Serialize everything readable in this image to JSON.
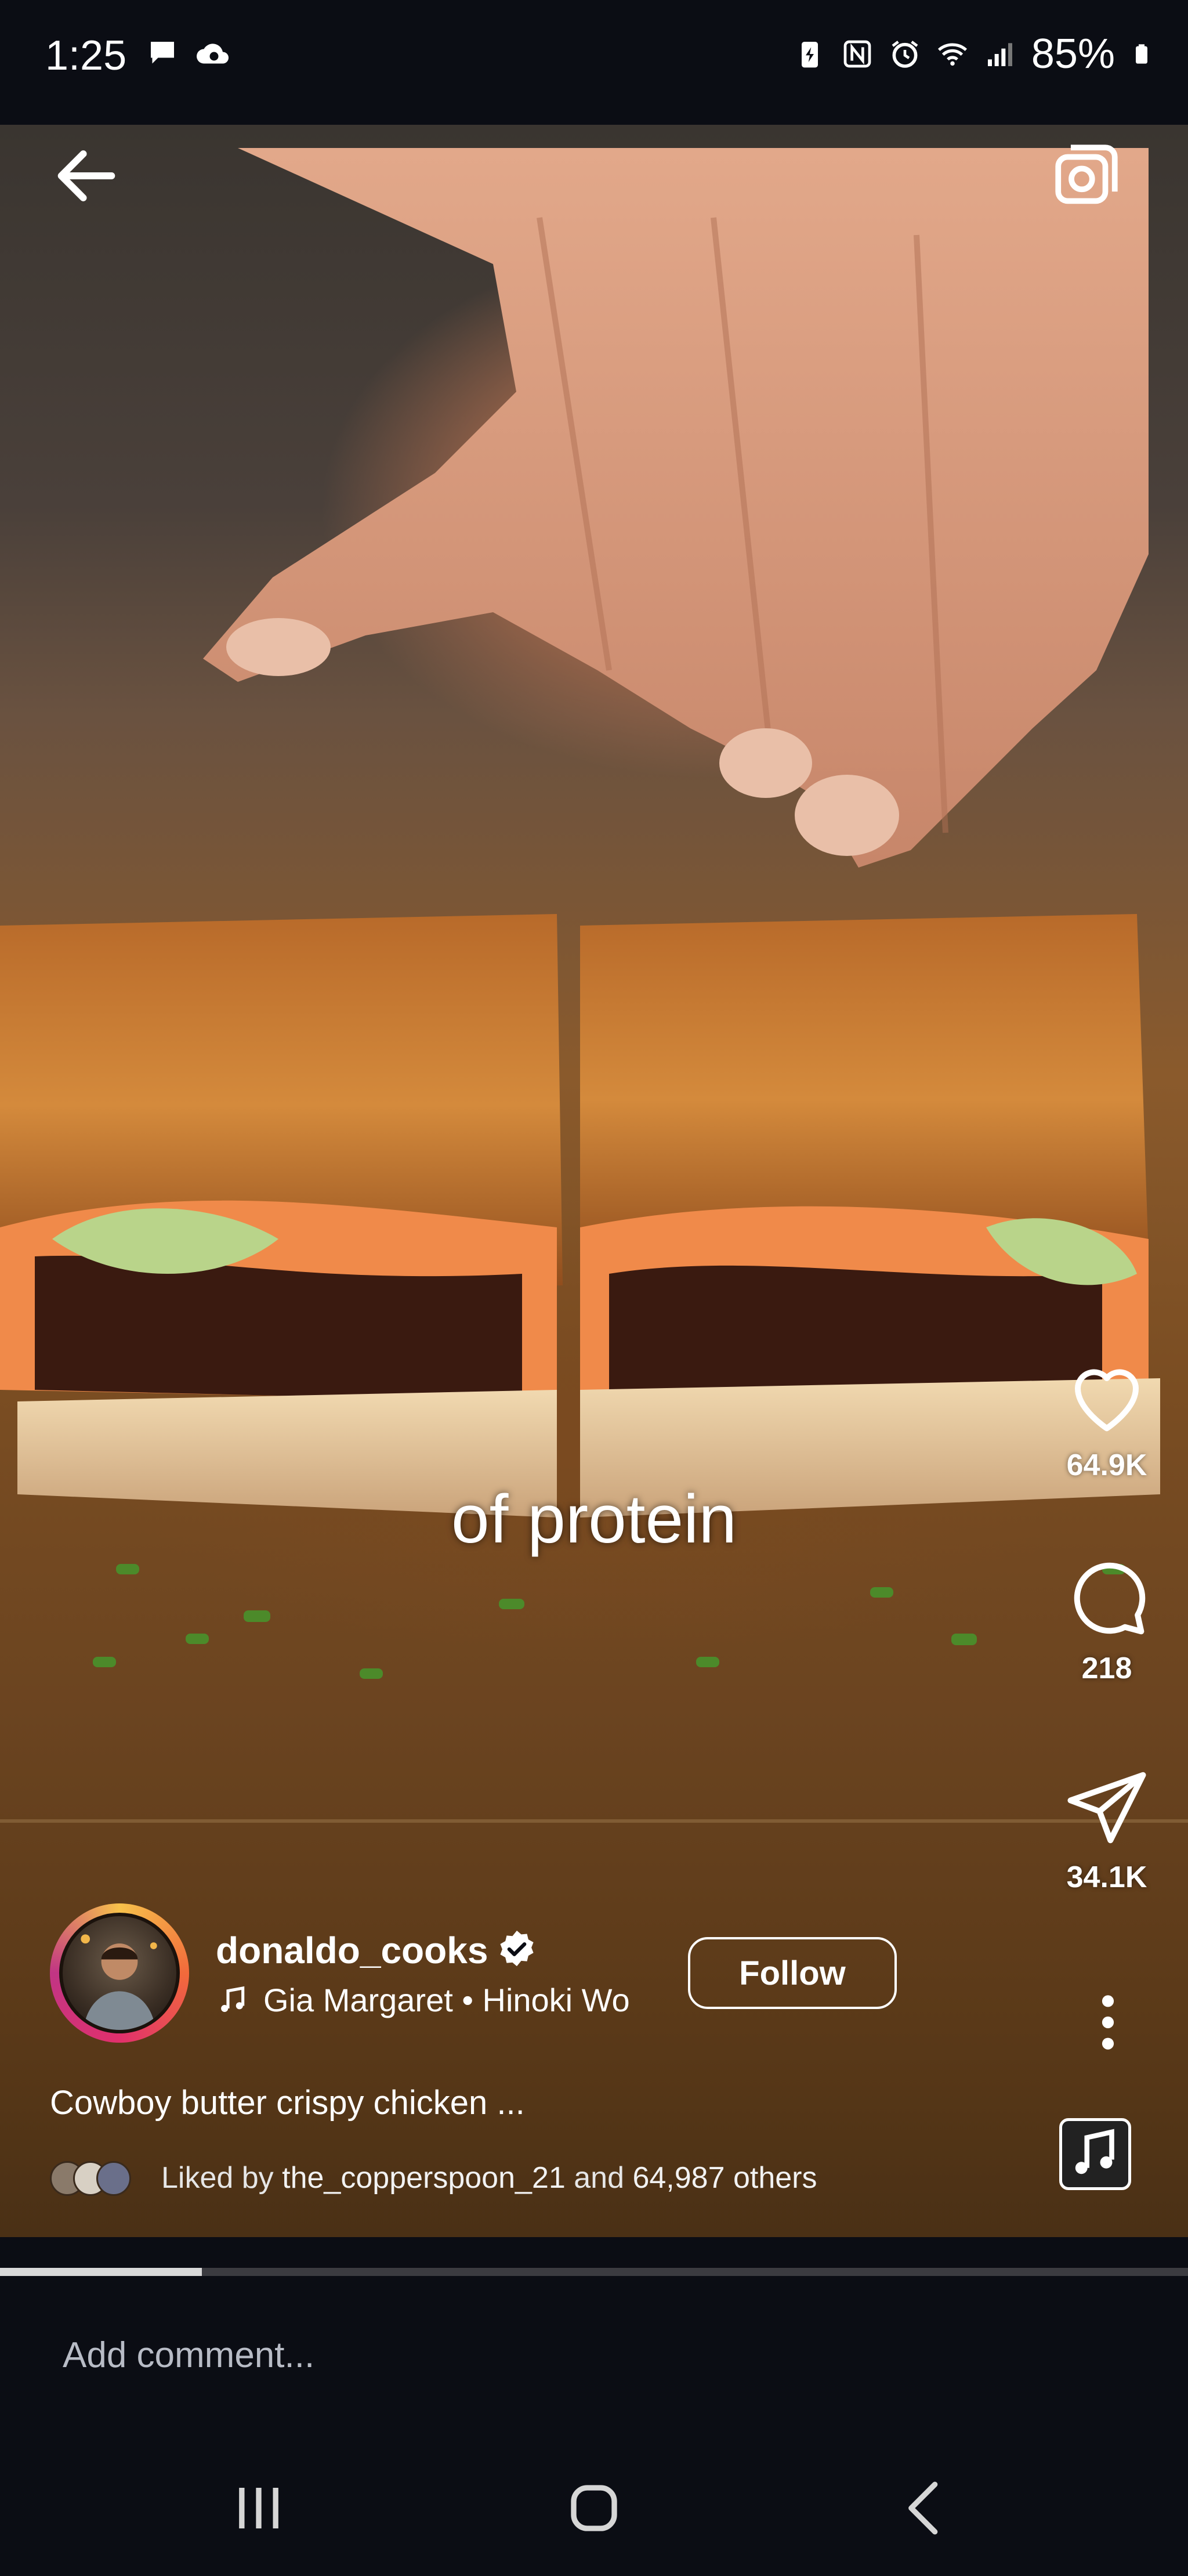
{
  "status_bar": {
    "time": "1:25",
    "battery": "85%",
    "left_icons": [
      "chat-bubble-icon",
      "cloud-icon"
    ],
    "right_icons": [
      "battery-saver-icon",
      "nfc-icon",
      "alarm-icon",
      "wifi-icon",
      "signal-icon",
      "battery-icon"
    ]
  },
  "reel": {
    "overlay_caption": "of protein",
    "likes_count": "64.9K",
    "comments_count": "218",
    "shares_count": "34.1K",
    "progress": 0.17
  },
  "author": {
    "username": "donaldo_cooks",
    "verified": true,
    "music": "Gia Margaret • Hinoki Wo",
    "follow_label": "Follow"
  },
  "post": {
    "caption": "Cowboy butter crispy chicken ...",
    "liked_by_prefix": "Liked by ",
    "liked_by_user": "the_copperspoon_21",
    "liked_by_middle": " and ",
    "liked_by_others": "64,987 others"
  },
  "comment": {
    "placeholder": "Add comment..."
  },
  "colors": {
    "background": "#0b0d14",
    "accent_ring": "#e1306c"
  }
}
